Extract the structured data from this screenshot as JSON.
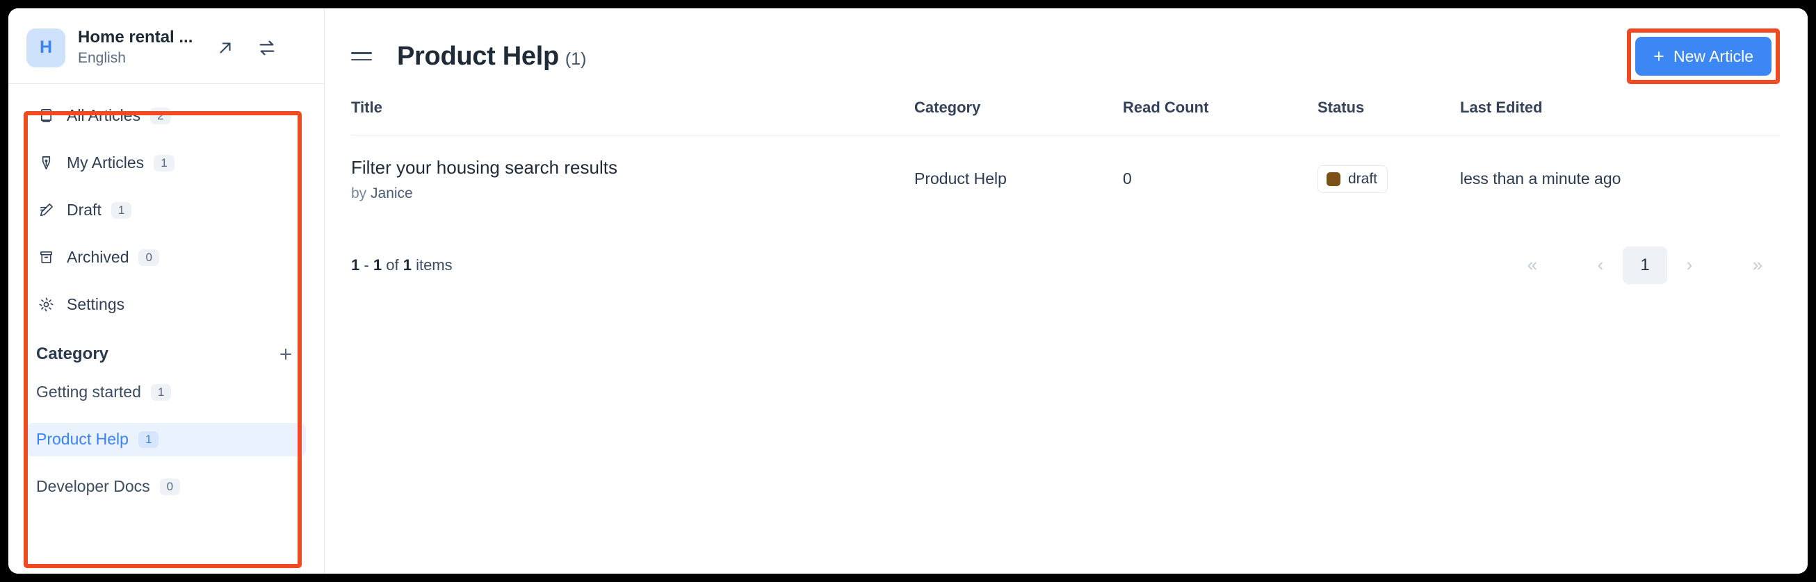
{
  "workspace": {
    "avatar_initial": "H",
    "name": "Home rental ...",
    "language": "English",
    "open_icon": "arrow-up-right-icon",
    "switch_icon": "switch-horizontal-icon"
  },
  "sidebar": {
    "nav_items": [
      {
        "label": "All Articles",
        "badge": "2",
        "icon": "book-icon",
        "name": "sidebar-item-all-articles"
      },
      {
        "label": "My Articles",
        "badge": "1",
        "icon": "pen-nib-icon",
        "name": "sidebar-item-my-articles"
      },
      {
        "label": "Draft",
        "badge": "1",
        "icon": "pencil-edit-icon",
        "name": "sidebar-item-draft"
      },
      {
        "label": "Archived",
        "badge": "0",
        "icon": "archive-box-icon",
        "name": "sidebar-item-archived"
      },
      {
        "label": "Settings",
        "badge": "",
        "icon": "gear-icon",
        "name": "sidebar-item-settings"
      }
    ],
    "category": {
      "title": "Category",
      "add_icon": "plus-icon",
      "items": [
        {
          "label": "Getting started",
          "badge": "1",
          "active": false,
          "name": "sidebar-category-getting-started"
        },
        {
          "label": "Product Help",
          "badge": "1",
          "active": true,
          "name": "sidebar-category-product-help"
        },
        {
          "label": "Developer Docs",
          "badge": "0",
          "active": false,
          "name": "sidebar-category-developer-docs"
        }
      ]
    }
  },
  "main": {
    "menu_icon": "hamburger-menu-icon",
    "title": "Product Help",
    "count": "(1)",
    "new_article_label": "New Article",
    "new_article_plus": "+"
  },
  "table": {
    "headers": [
      "Title",
      "Category",
      "Read Count",
      "Status",
      "Last Edited"
    ],
    "rows": [
      {
        "title": "Filter your housing search results",
        "by_prefix": "by",
        "author": "Janice",
        "category": "Product Help",
        "read_count": "0",
        "status": "draft",
        "status_color": "#7b5117",
        "last_edited": "less than a minute ago"
      }
    ]
  },
  "pagination": {
    "range_start": "1",
    "range_sep": "-",
    "range_end": "1",
    "of_text": "of",
    "total": "1",
    "items_text": "items",
    "first_label": "«",
    "prev_label": "‹",
    "current_page": "1",
    "next_label": "›",
    "last_label": "»"
  },
  "colors": {
    "accent_blue": "#3d87f5",
    "annotation_red": "#f04a23",
    "active_bg": "#eaf2fe",
    "draft_brown": "#7b5117"
  }
}
